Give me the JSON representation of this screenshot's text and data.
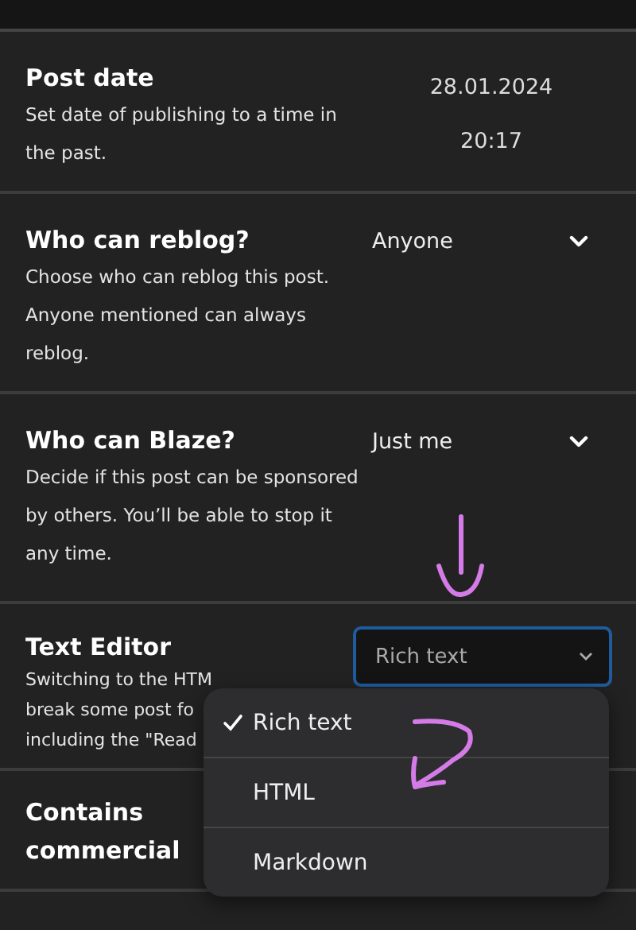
{
  "sections": [
    {
      "kind": "date",
      "title": "Post date",
      "description": [
        "Set date of publishing to a time in the past."
      ],
      "date": "28.01.2024",
      "time": "20:17"
    },
    {
      "kind": "select",
      "title": "Who can reblog?",
      "description": [
        "Choose who can reblog this post. Anyone mentioned can always reblog."
      ],
      "value": "Anyone"
    },
    {
      "kind": "select",
      "title": "Who can Blaze?",
      "description": [
        "Decide if this post can be sponsored by others. You’ll be able to stop it any time."
      ],
      "value": "Just me"
    },
    {
      "kind": "editor",
      "title": "Text Editor",
      "description": [
        "Switching to the HTM",
        "break some post fo",
        "including the \"Read"
      ],
      "value": "Rich text",
      "focused": true,
      "menu": [
        {
          "label": "Rich text",
          "selected": true
        },
        {
          "label": "HTML",
          "selected": false
        },
        {
          "label": "Markdown",
          "selected": false
        }
      ]
    },
    {
      "kind": "plain",
      "title": "Contains commercial"
    }
  ]
}
